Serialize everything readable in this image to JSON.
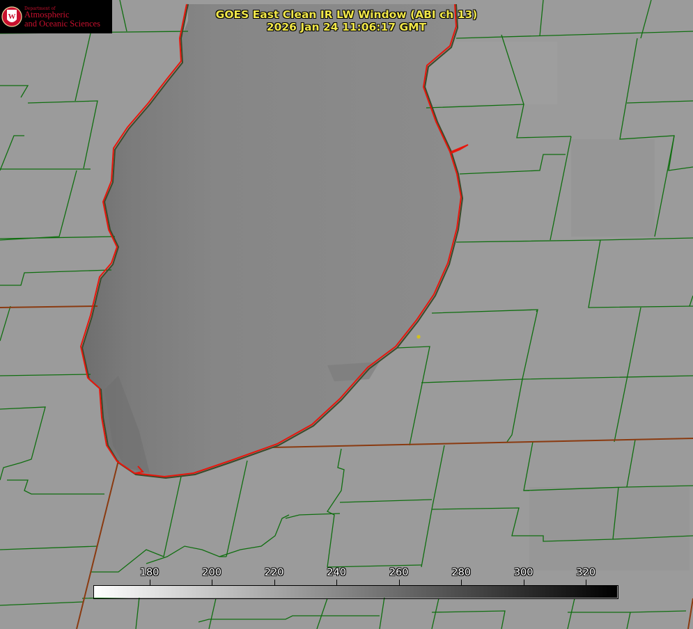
{
  "logo": {
    "department": "Department of",
    "line1": "Atmospheric",
    "line2": "and Oceanic Sciences",
    "seal_icon": "uw-crest-icon",
    "seal_letter": "W",
    "color": "#c8102e"
  },
  "title": {
    "line1": "GOES East Clean IR LW Window (ABI ch 13)",
    "line2": "2026 Jan 24 11:06:17 GMT",
    "color": "#f2e84a"
  },
  "colorbar": {
    "ticks": [
      "180",
      "200",
      "220",
      "240",
      "260",
      "280",
      "300",
      "320"
    ],
    "tick_values": [
      180,
      200,
      220,
      240,
      260,
      280,
      300,
      320
    ],
    "range": [
      162,
      330
    ],
    "gradient": [
      "#ffffff",
      "#000000"
    ]
  },
  "map_colors": {
    "county_lines": "#0f6e0f",
    "state_lines": "#8a3a10",
    "shoreline": "#e8160c",
    "marker": "#d4c21a"
  }
}
